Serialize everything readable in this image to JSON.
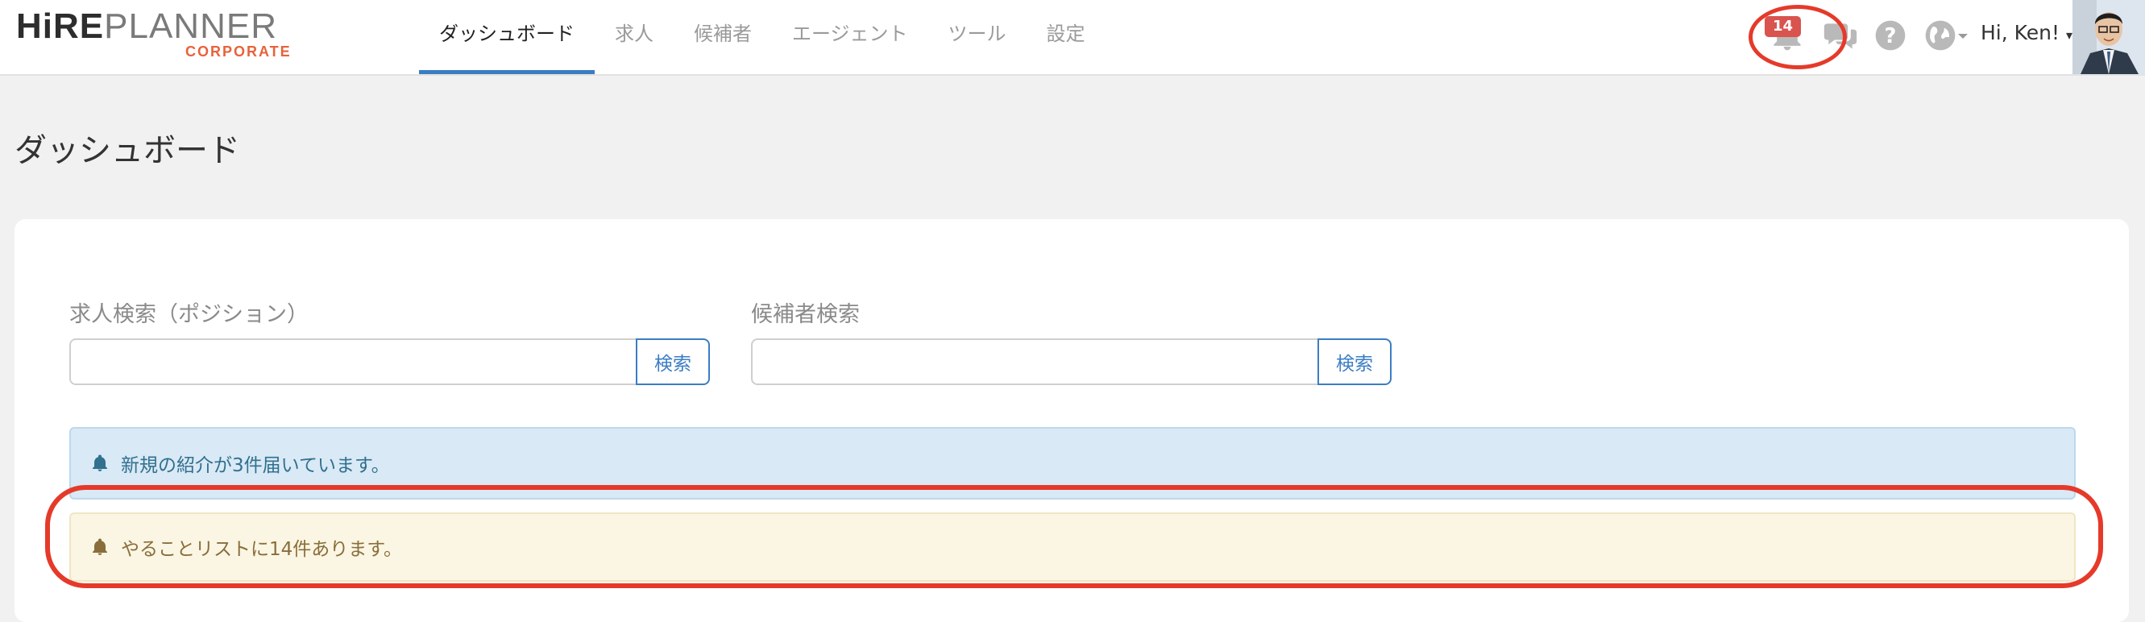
{
  "logo": {
    "hire": "HiRE",
    "planner": "PLANNER",
    "sub": "CORPORATE"
  },
  "nav": {
    "items": [
      {
        "label": "ダッシュボード"
      },
      {
        "label": "求人"
      },
      {
        "label": "候補者"
      },
      {
        "label": "エージェント"
      },
      {
        "label": "ツール"
      },
      {
        "label": "設定"
      }
    ]
  },
  "header": {
    "notification_count": "14",
    "greeting": "Hi, Ken!",
    "icons": [
      "bell-icon",
      "chat-icon",
      "help-icon",
      "globe-icon",
      "caret-down-icon"
    ]
  },
  "page": {
    "title": "ダッシュボード"
  },
  "search": {
    "job_label": "求人検索（ポジション）",
    "job_value": "",
    "job_button": "検索",
    "candidate_label": "候補者検索",
    "candidate_value": "",
    "candidate_button": "検索"
  },
  "alerts": {
    "info": "新規の紹介が3件届いています。",
    "warning": "やることリストに14件あります。"
  },
  "colors": {
    "accent": "#3b7dc4",
    "brand_orange": "#e8623a",
    "highlight": "#e53a2a",
    "badge": "#d9534f"
  }
}
